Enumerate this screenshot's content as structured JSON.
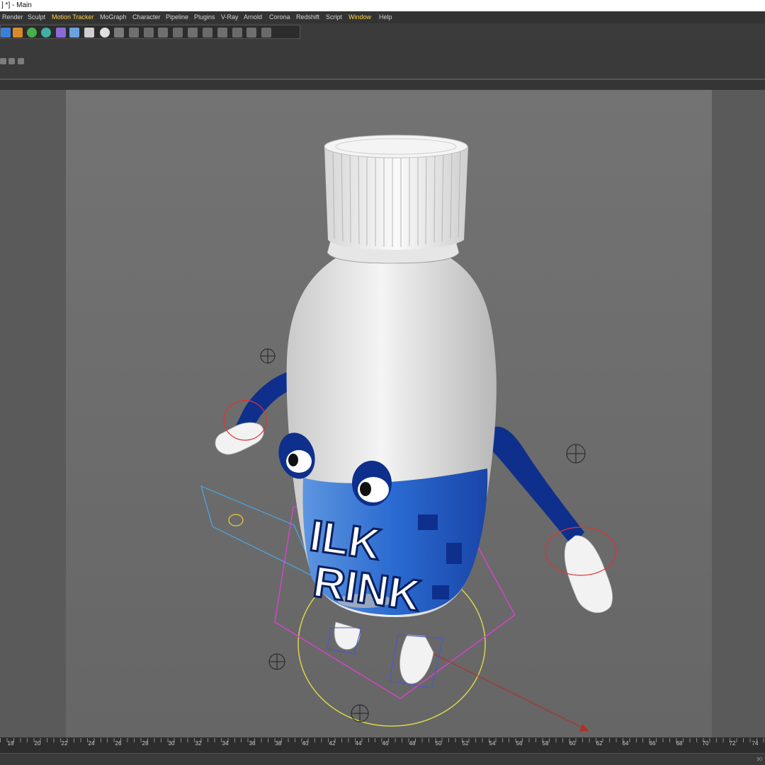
{
  "window": {
    "title": "] *] - Main"
  },
  "menu": {
    "items": [
      "Render",
      "Sculpt",
      "Motion Tracker",
      "MoGraph",
      "Character",
      "Pipeline",
      "Plugins",
      "V-Ray",
      "Arnold",
      "Corona",
      "Redshift",
      "Script",
      "Window",
      "Help"
    ],
    "highlighted": [
      "Motion Tracker",
      "Window"
    ],
    "highlight_color": "#ffd34a"
  },
  "toolbar": {
    "icons": [
      "cube-icon",
      "pen-icon",
      "subdivision-icon",
      "array-icon",
      "deformer-icon",
      "floor-icon",
      "camera-icon",
      "light-icon",
      "grid-tool-icon",
      "mesh-tool-icon",
      "join-tool-icon",
      "branch-tool-icon",
      "sweep-tool-icon",
      "bevel-tool-icon",
      "extrude-tool-icon",
      "knife-tool-icon",
      "matrix-tool-icon",
      "pattern-tool-icon",
      "cloner-tool-icon"
    ]
  },
  "viewport": {
    "label_text": [
      "ILK",
      "RINK"
    ],
    "colors": {
      "background": "#6e6e6e",
      "bottle": "#f2f2f2",
      "label_blue": "#1f4fbf",
      "arm_blue": "#0e2f8c"
    }
  },
  "timeline": {
    "labels": [
      "18",
      "20",
      "22",
      "24",
      "26",
      "28",
      "30",
      "32",
      "34",
      "36",
      "38",
      "40",
      "42",
      "44",
      "46",
      "48",
      "50",
      "52",
      "54",
      "56",
      "58",
      "60",
      "62",
      "64",
      "66",
      "68",
      "70",
      "72",
      "74"
    ],
    "end_text": "90"
  }
}
